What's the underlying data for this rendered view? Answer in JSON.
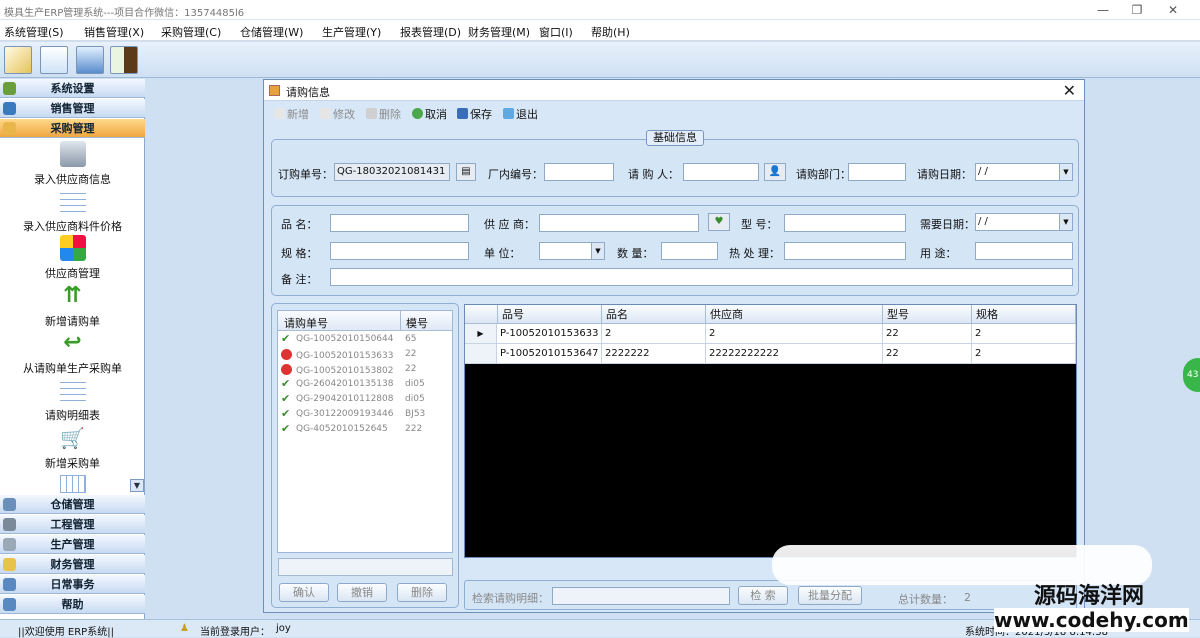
{
  "window": {
    "title": "模具生产ERP管理系统---项目合作微信：13574485l6",
    "minimize": "—",
    "restore": "❐",
    "close": "✕"
  },
  "menu": [
    "系统管理(S)",
    "销售管理(X)",
    "采购管理(C)",
    "仓储管理(W)",
    "生产管理(Y)",
    "报表管理(D)",
    "财务管理(M)",
    "窗口(I)",
    "帮助(H)"
  ],
  "sidebar": {
    "headers": [
      "系统设置",
      "销售管理",
      "采购管理"
    ],
    "items": [
      "录入供应商信息",
      "录入供应商料件价格",
      "供应商管理",
      "新增请购单",
      "从请购单生产采购单",
      "请购明细表",
      "新增采购单"
    ],
    "footer_headers": [
      "仓储管理",
      "工程管理",
      "生产管理",
      "财务管理",
      "日常事务",
      "帮助"
    ]
  },
  "dialog": {
    "title": "请购信息",
    "toolbar": {
      "new": "新增",
      "edit": "修改",
      "delete": "删除",
      "cancel": "取消",
      "save": "保存",
      "exit": "退出"
    },
    "basic_info": {
      "legend": "基础信息",
      "order_no_label": "订购单号：",
      "order_no_value": "QG-18032021081431",
      "factory_no_label": "厂内编号：",
      "factory_no_value": "",
      "requester_label": "请 购 人：",
      "requester_value": "",
      "dept_label": "请购部门：",
      "dept_value": "",
      "date_label": "请购日期：",
      "date_value": "  /   /"
    },
    "detail": {
      "name_label": "品    名：",
      "supplier_label": "供 应 商：",
      "model_label": "型    号：",
      "need_date_label": "需要日期：",
      "need_date_value": "  /   /",
      "spec_label": "规    格：",
      "unit_label": "单    位：",
      "qty_label": "数    量：",
      "heat_label": "热 处 理：",
      "use_label": "用    途：",
      "note_label": "备    注："
    },
    "list": {
      "headers": [
        "请购单号",
        "模号"
      ],
      "rows": [
        {
          "id": "QG-10052010150644",
          "mold": "65",
          "status": "ok"
        },
        {
          "id": "QG-10052010153633",
          "mold": "22",
          "status": "no"
        },
        {
          "id": "QG-10052010153802",
          "mold": "22",
          "status": "no"
        },
        {
          "id": "QG-26042010135138",
          "mold": "di05",
          "status": "ok"
        },
        {
          "id": "QG-29042010112808",
          "mold": "di05",
          "status": "ok"
        },
        {
          "id": "QG-30122009193446",
          "mold": "BJ53",
          "status": "ok"
        },
        {
          "id": "QG-4052010152645",
          "mold": "222",
          "status": "ok"
        }
      ],
      "buttons": {
        "confirm": "确认",
        "revoke": "撤销",
        "remove": "删除"
      }
    },
    "grid": {
      "headers": [
        "品号",
        "品名",
        "供应商",
        "型号",
        "规格"
      ],
      "rows": [
        [
          "P-10052010153633",
          "2",
          "2",
          "22",
          "2"
        ],
        [
          "P-10052010153647",
          "2222222",
          "22222222222",
          "22",
          "2"
        ]
      ]
    },
    "bottom": {
      "search_label": "检索请购明细：",
      "search_btn": "检   索",
      "batch_btn": "批量分配",
      "total_label": "总计数量：",
      "total_value": "2"
    }
  },
  "statusbar": {
    "welcome": "||欢迎使用 ERP系统||",
    "user_label": "当前登录用户：",
    "user": "joy",
    "time": "系统时间：2021/3/18  8:14:38"
  },
  "watermark": {
    "line1": "源码海洋网",
    "line2": "www.codehy.com"
  },
  "green_badge": "43"
}
